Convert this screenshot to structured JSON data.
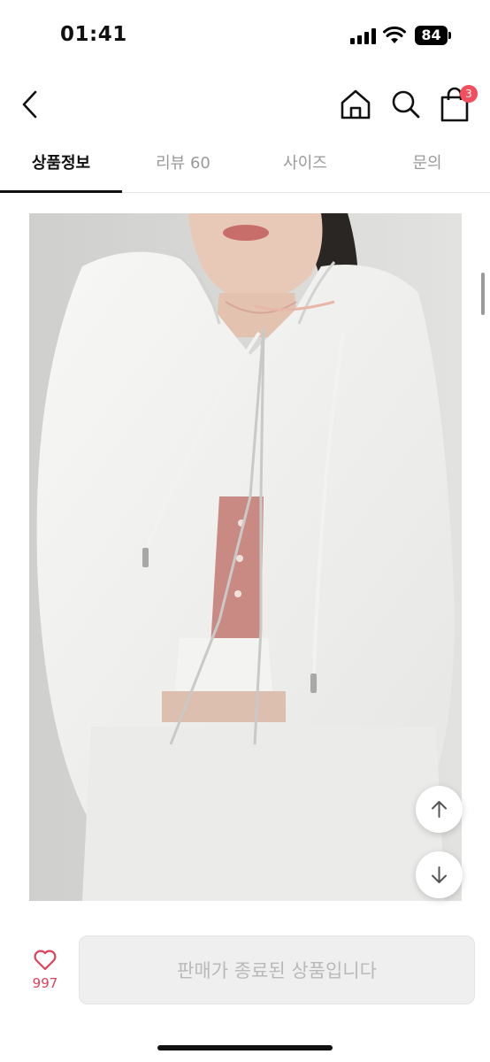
{
  "status_bar": {
    "time": "01:41",
    "battery_level": "84",
    "icons": [
      "signal-icon",
      "wifi-icon",
      "battery-icon"
    ]
  },
  "header": {
    "icons": [
      "back-arrow-icon",
      "home-icon",
      "search-icon",
      "cart-icon"
    ],
    "cart_badge": "3"
  },
  "tabs": [
    {
      "label": "상품정보",
      "active": true
    },
    {
      "label": "리뷰 60",
      "active": false
    },
    {
      "label": "사이즈",
      "active": false
    },
    {
      "label": "문의",
      "active": false
    }
  ],
  "floating_buttons": {
    "icons": [
      "arrow-up-icon",
      "arrow-down-icon"
    ]
  },
  "bottom_bar": {
    "like_count": "997",
    "soldout_label": "판매가 종료된 상품입니다",
    "like_color": "#e0415a"
  },
  "colors": {
    "badge": "#f24e5d",
    "active_tab": "#111111",
    "inactive_tab": "#9a9a9a"
  }
}
